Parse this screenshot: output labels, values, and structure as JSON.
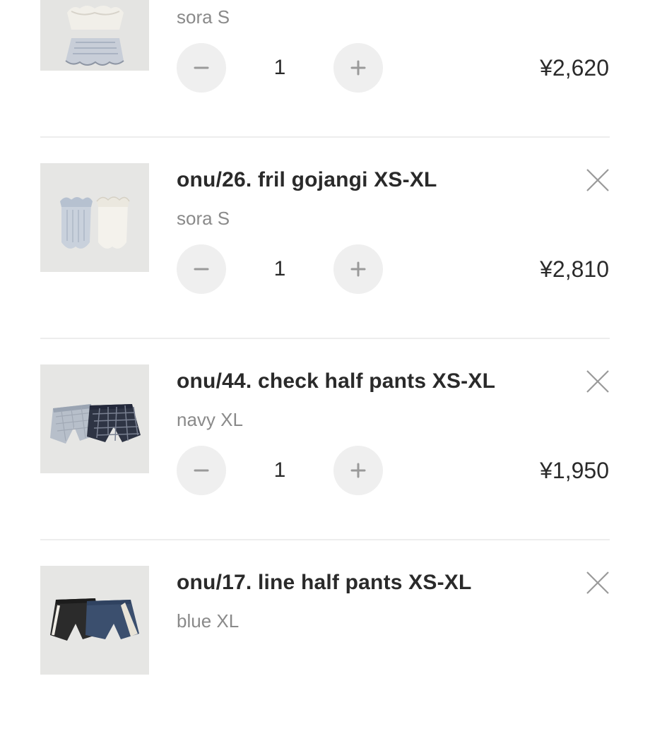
{
  "cart": {
    "items": [
      {
        "name": "",
        "variant": "sora S",
        "quantity": "1",
        "price": "¥2,620",
        "thumbnail_icon": "product-photo-icon",
        "remove_icon": "close-icon"
      },
      {
        "name": "onu/26. fril gojangi XS-XL",
        "variant": "sora S",
        "quantity": "1",
        "price": "¥2,810",
        "thumbnail_icon": "product-photo-icon",
        "remove_icon": "close-icon"
      },
      {
        "name": "onu/44. check half pants XS-XL",
        "variant": "navy XL",
        "quantity": "1",
        "price": "¥1,950",
        "thumbnail_icon": "product-photo-icon",
        "remove_icon": "close-icon"
      },
      {
        "name": "onu/17. line half pants XS-XL",
        "variant": "blue XL",
        "quantity": "",
        "price": "",
        "thumbnail_icon": "product-photo-icon",
        "remove_icon": "close-icon"
      }
    ]
  },
  "colors": {
    "button_bg": "#efefef",
    "divider": "#ededed",
    "text_primary": "#2a2a2a",
    "text_secondary": "#8a8a8a"
  }
}
